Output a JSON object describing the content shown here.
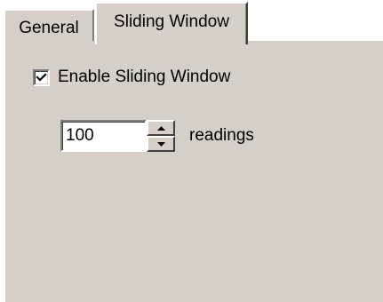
{
  "tabs": [
    {
      "label": "General",
      "active": false
    },
    {
      "label": "Sliding Window",
      "active": true
    }
  ],
  "checkbox": {
    "label": "Enable Sliding Window",
    "checked": true
  },
  "spin": {
    "value": "100",
    "unit_label": "readings"
  },
  "colors": {
    "face": "#d4d0c8",
    "highlight": "#ffffff",
    "shadow": "#808080",
    "dark_shadow": "#404040"
  }
}
